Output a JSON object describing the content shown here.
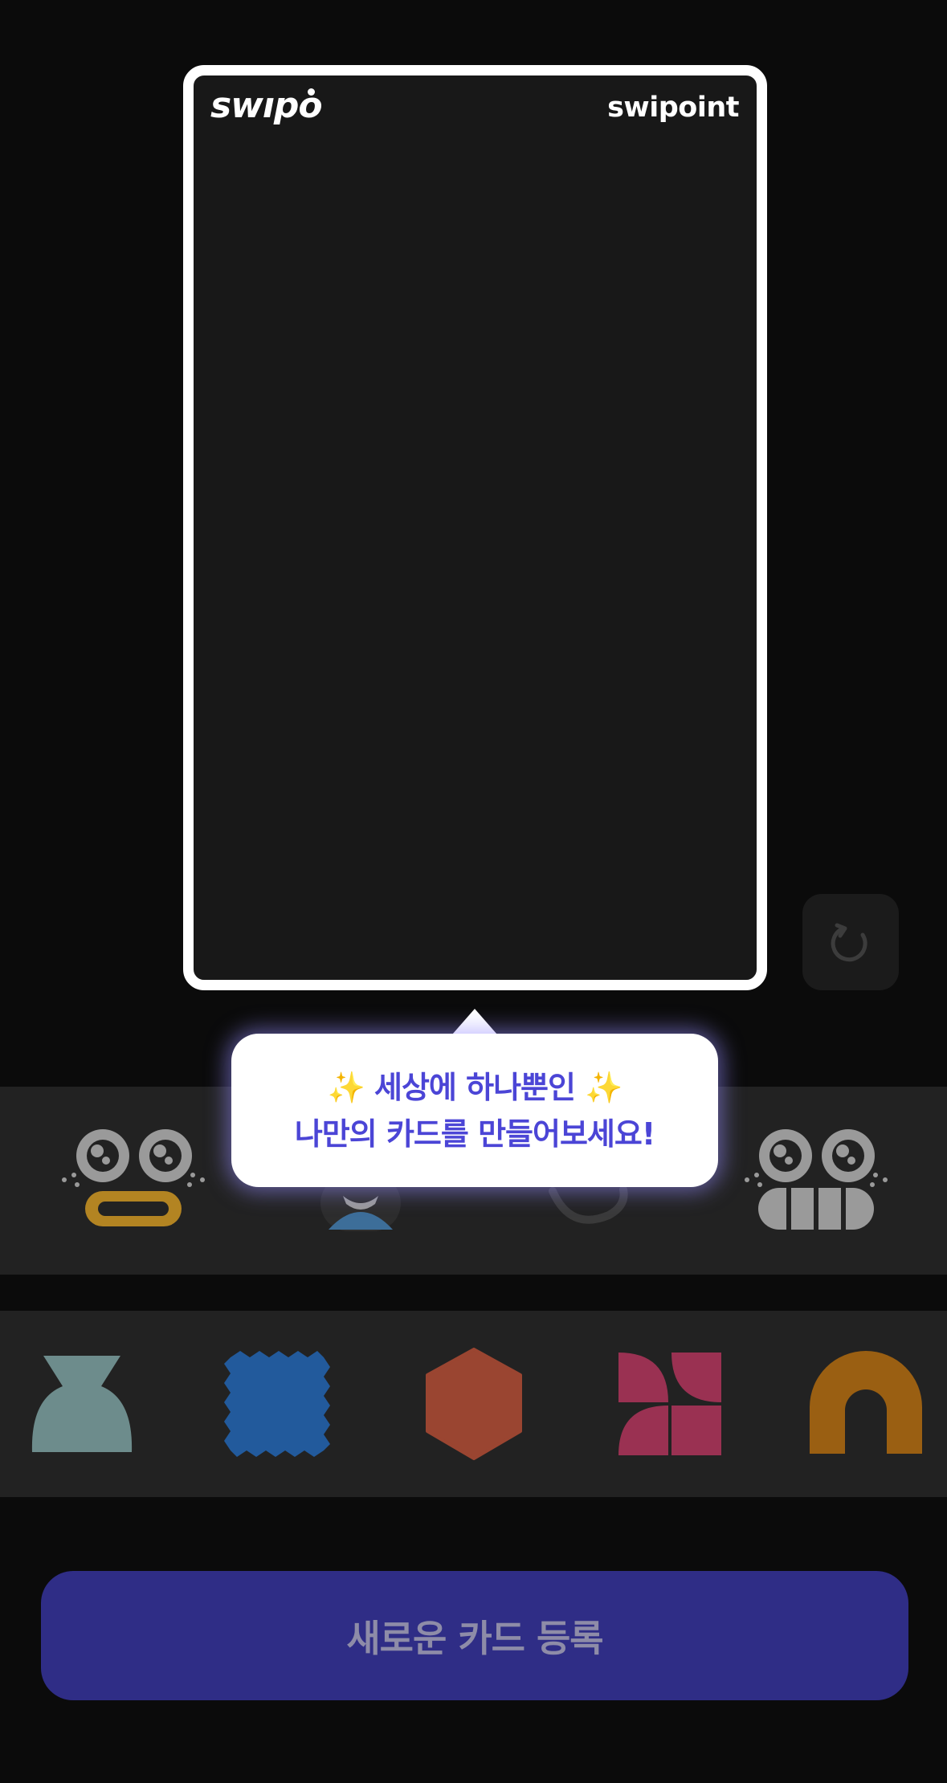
{
  "card": {
    "logo": "swıpo",
    "brand": "swipoint",
    "background_color": "#181818",
    "border_color": "#ffffff"
  },
  "reset_button": {
    "icon": "refresh-icon"
  },
  "tooltip": {
    "line1": "✨ 세상에 하나뿐인 ✨",
    "line2": "나만의 카드를 만들어보세요!",
    "text_color": "#4b45d6"
  },
  "faces": [
    {
      "name": "face-goggle-mouth",
      "mouth_color": "#b38422"
    },
    {
      "name": "face-mustache",
      "mouth_color": "#3d6e99"
    },
    {
      "name": "face-smile",
      "mouth_color": "#3a3a3a"
    },
    {
      "name": "face-teeth-grin",
      "mouth_color": "#9a9a9a"
    }
  ],
  "shapes": [
    {
      "name": "shape-vase",
      "color": "#6d8c8c"
    },
    {
      "name": "shape-stamp",
      "color": "#225a9c"
    },
    {
      "name": "shape-hexagon",
      "color": "#9a4531"
    },
    {
      "name": "shape-pinwheel",
      "color": "#9a3152"
    },
    {
      "name": "shape-arch",
      "color": "#9a5f12"
    }
  ],
  "register_button": {
    "label": "새로운 카드 등록",
    "color": "#2f2d86"
  }
}
